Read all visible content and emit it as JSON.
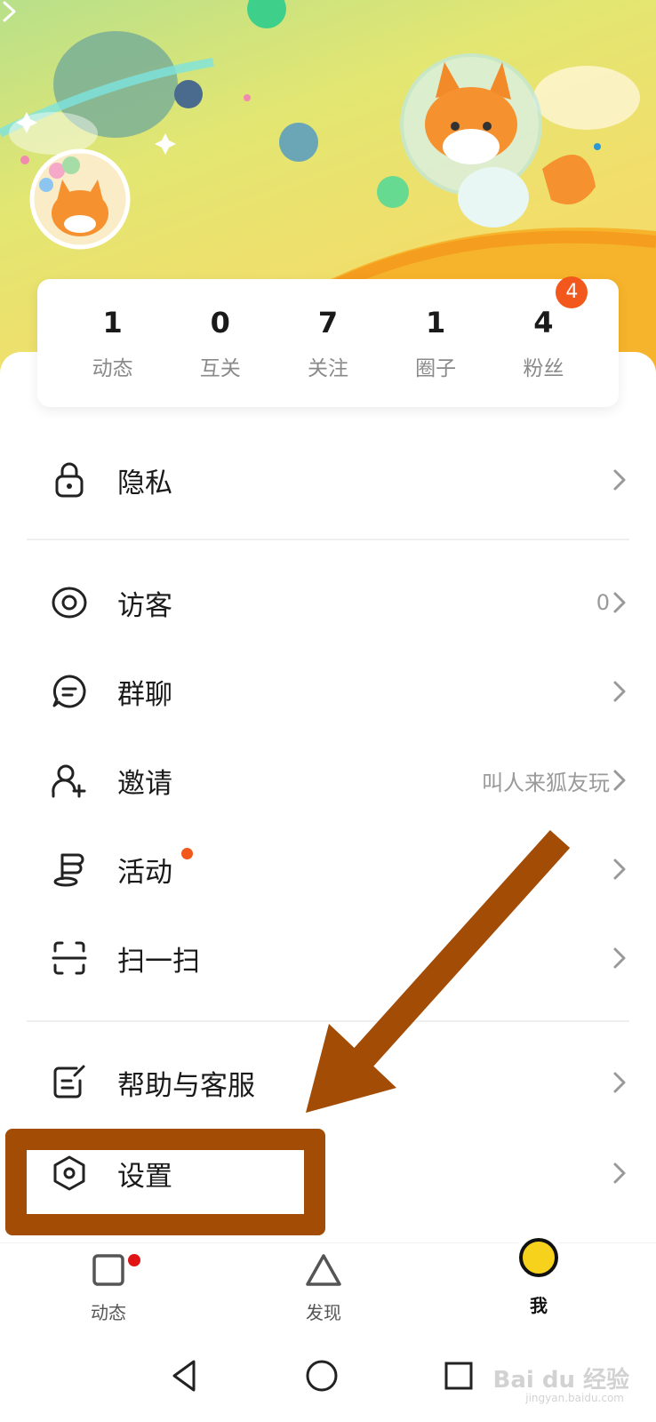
{
  "stats": [
    {
      "value": "1",
      "label": "动态"
    },
    {
      "value": "0",
      "label": "互关"
    },
    {
      "value": "7",
      "label": "关注"
    },
    {
      "value": "1",
      "label": "圈子"
    },
    {
      "value": "4",
      "label": "粉丝",
      "badge": "4"
    }
  ],
  "menu": {
    "privacy": {
      "label": "隐私",
      "icon": "lock-icon"
    },
    "visitors": {
      "label": "访客",
      "value": "0",
      "icon": "eye-icon"
    },
    "group_chat": {
      "label": "群聊",
      "icon": "chat-icon"
    },
    "invite": {
      "label": "邀请",
      "value": "叫人来狐友玩",
      "icon": "add-user-icon"
    },
    "activity": {
      "label": "活动",
      "icon": "flag-icon"
    },
    "scan": {
      "label": "扫一扫",
      "icon": "scan-icon"
    },
    "help": {
      "label": "帮助与客服",
      "icon": "edit-note-icon"
    },
    "settings": {
      "label": "设置",
      "icon": "hexagon-settings-icon"
    }
  },
  "tabs": [
    {
      "label": "动态",
      "icon": "square-icon"
    },
    {
      "label": "发现",
      "icon": "triangle-icon"
    },
    {
      "label": "我",
      "icon": "profile-circle-icon"
    }
  ],
  "watermark": {
    "text": "Bai du 经验",
    "sub": "jingyan.baidu.com"
  },
  "colors": {
    "accent": "#f2581c",
    "annotation": "#a24c06",
    "banner": "#e9e26e"
  }
}
